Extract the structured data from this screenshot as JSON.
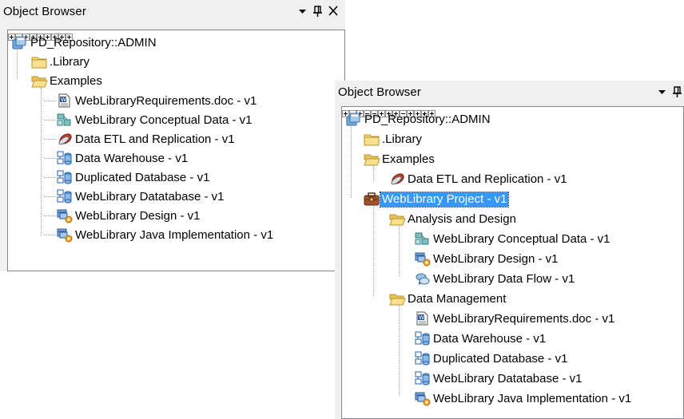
{
  "panel_left": {
    "title": "Object Browser",
    "root": "PD_Repository::ADMIN",
    "items": [
      {
        "label": ".Library",
        "icon": "folder-icon"
      },
      {
        "label": "Examples",
        "icon": "folder-open-icon"
      },
      {
        "label": "WebLibraryRequirements.doc - v1",
        "icon": "word-document-icon"
      },
      {
        "label": "WebLibrary Conceptual Data - v1",
        "icon": "conceptual-data-model-icon"
      },
      {
        "label": "Data ETL and Replication - v1",
        "icon": "etl-replication-icon"
      },
      {
        "label": "Data Warehouse - v1",
        "icon": "physical-data-model-icon"
      },
      {
        "label": "Duplicated Database - v1",
        "icon": "physical-data-model-icon"
      },
      {
        "label": "WebLibrary Datatabase - v1",
        "icon": "physical-data-model-icon"
      },
      {
        "label": "WebLibrary Design - v1",
        "icon": "oo-model-icon"
      },
      {
        "label": "WebLibrary Java Implementation - v1",
        "icon": "oo-model-icon"
      }
    ]
  },
  "panel_right": {
    "title": "Object Browser",
    "root": "PD_Repository::ADMIN",
    "items": [
      {
        "label": ".Library",
        "icon": "folder-icon"
      },
      {
        "label": "Examples",
        "icon": "folder-open-icon"
      },
      {
        "label": "Data ETL and Replication - v1",
        "icon": "etl-replication-icon"
      },
      {
        "label": "WebLibrary Project - v1",
        "icon": "project-briefcase-icon"
      },
      {
        "label": "Analysis and Design",
        "icon": "folder-open-icon"
      },
      {
        "label": "WebLibrary Conceptual Data - v1",
        "icon": "conceptual-data-model-icon"
      },
      {
        "label": "WebLibrary Design - v1",
        "icon": "oo-model-icon"
      },
      {
        "label": "WebLibrary Data Flow - v1",
        "icon": "data-flow-model-icon"
      },
      {
        "label": "Data Management",
        "icon": "folder-open-icon"
      },
      {
        "label": "WebLibraryRequirements.doc - v1",
        "icon": "word-document-icon"
      },
      {
        "label": "Data Warehouse - v1",
        "icon": "physical-data-model-icon"
      },
      {
        "label": "Duplicated Database - v1",
        "icon": "physical-data-model-icon"
      },
      {
        "label": "WebLibrary Datatabase - v1",
        "icon": "physical-data-model-icon"
      },
      {
        "label": "WebLibrary Java Implementation - v1",
        "icon": "oo-model-icon"
      }
    ],
    "selected_item": "WebLibrary Project - v1"
  },
  "controls": {
    "dropdown_icon": "dropdown-arrow-icon",
    "pin_icon": "pin-icon",
    "close_icon": "close-icon"
  },
  "colors": {
    "selection": "#3399ff",
    "panel_bg": "#f0f0f0",
    "tree_border": "#828790"
  }
}
